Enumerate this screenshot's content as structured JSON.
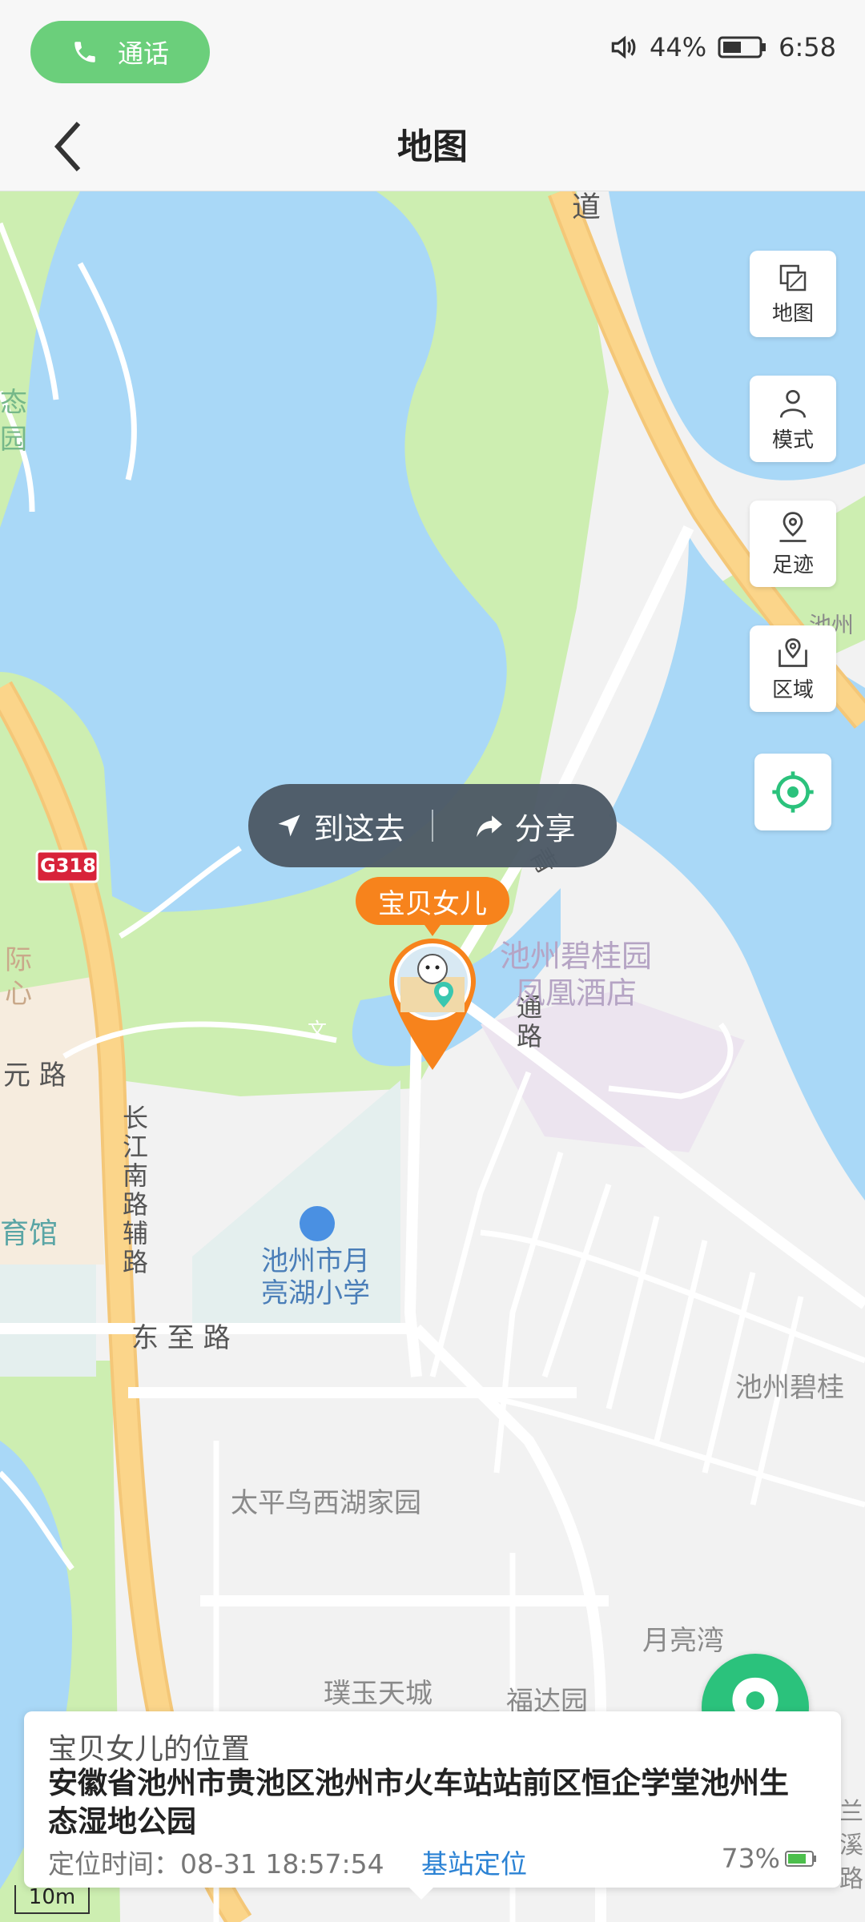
{
  "status_bar": {
    "call_label": "通话",
    "battery_percent": "44%",
    "time": "6:58"
  },
  "header": {
    "title": "地图"
  },
  "side_buttons": [
    {
      "label": "地图",
      "icon": "layers-icon"
    },
    {
      "label": "模式",
      "icon": "person-icon"
    },
    {
      "label": "足迹",
      "icon": "footprint-pin-icon"
    },
    {
      "label": "区域",
      "icon": "area-pin-icon"
    }
  ],
  "action_bubble": {
    "go_label": "到这去",
    "share_label": "分享"
  },
  "marker": {
    "name": "宝贝女儿"
  },
  "map_labels": {
    "road_dao": "道",
    "road_tong": "通路",
    "road_tong_prefix": "青",
    "hotel": "池州碧桂园\n凤凰酒店",
    "school": "池州市月\n亮湖小学",
    "dongzhi_road": "东 至 路",
    "changjiang_road": "长江南路辅路",
    "yuan_road": "元 路",
    "g318": "G318",
    "gym": "育馆",
    "ji": "际",
    "xin": "心",
    "taiping": "太平鸟西湖家园",
    "pu_yu": "璞玉天城",
    "fuda": "福达园",
    "yueliang_wan": "月亮湾",
    "biguiyuan_right": "池州碧桂",
    "chizhou_top": "池州",
    "tai": "态",
    "yuan": "园",
    "lan": "兰",
    "xi": "溪",
    "lu": "路"
  },
  "info_card": {
    "title": "宝贝女儿的位置",
    "address": "安徽省池州市贵池区池州市火车站站前区恒企学堂池州生态湿地公园",
    "time_label": "定位时间：08-31 18:57:54",
    "method": "基站定位",
    "battery": "73%"
  },
  "scale_label": "10m",
  "colors": {
    "water": "#a9d8f7",
    "park": "#cdeeb1",
    "road_major": "#fbd58a",
    "accent_green": "#2bc27c",
    "marker_orange": "#f7831c",
    "link_blue": "#2b82d4"
  }
}
